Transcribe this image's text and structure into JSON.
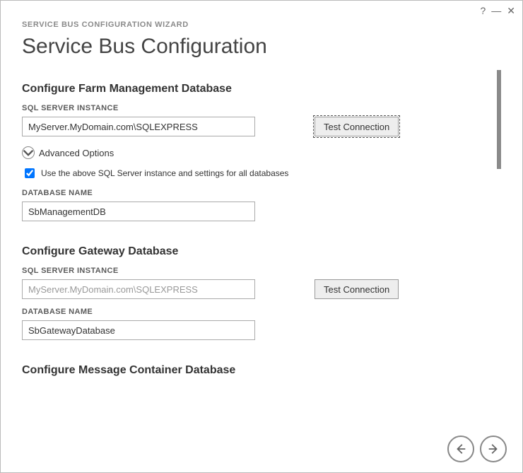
{
  "window": {
    "help_glyph": "?",
    "minimize_glyph": "—",
    "close_glyph": "✕"
  },
  "wizard_label": "SERVICE BUS CONFIGURATION WIZARD",
  "page_title": "Service Bus Configuration",
  "farm": {
    "heading": "Configure Farm Management Database",
    "sql_label": "SQL SERVER INSTANCE",
    "sql_value": "MyServer.MyDomain.com\\SQLEXPRESS",
    "test_btn": "Test Connection",
    "adv_label": "Advanced Options",
    "use_same_label": "Use the above SQL Server instance and settings for all databases",
    "db_label": "DATABASE NAME",
    "db_value": "SbManagementDB"
  },
  "gateway": {
    "heading": "Configure Gateway Database",
    "sql_label": "SQL SERVER INSTANCE",
    "sql_value": "MyServer.MyDomain.com\\SQLEXPRESS",
    "test_btn": "Test Connection",
    "db_label": "DATABASE NAME",
    "db_value": "SbGatewayDatabase"
  },
  "container": {
    "heading": "Configure Message Container Database"
  }
}
